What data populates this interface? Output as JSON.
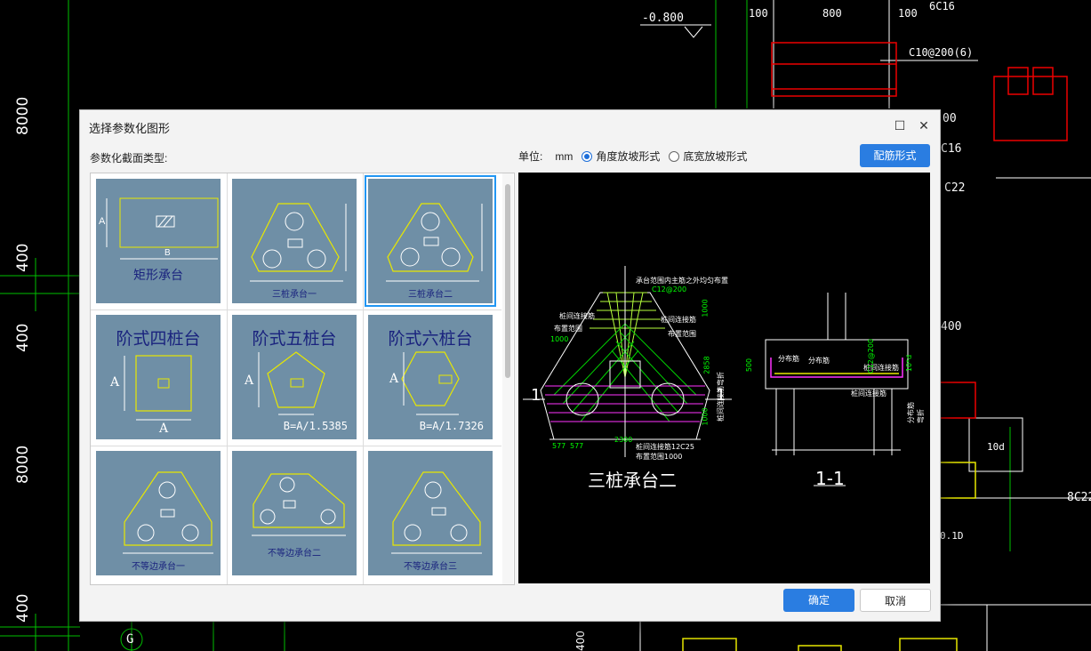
{
  "background_cad": {
    "dims": [
      "-0.800",
      "100",
      "800",
      "100",
      "6C16",
      "C10@200(6)",
      "8000",
      "400",
      "400",
      "8000",
      "400",
      "C22",
      "C16",
      "00",
      "400",
      "8C22",
      "10d",
      "0.1D",
      "G",
      "400"
    ]
  },
  "dialog": {
    "title": "选择参数化图形",
    "section_label": "参数化截面类型:",
    "unit_label": "单位:",
    "unit_value": "mm",
    "radio_angle": "角度放坡形式",
    "radio_width": "底宽放坡形式",
    "selected_radio": "angle",
    "rebar_button": "配筋形式",
    "ok_button": "确定",
    "cancel_button": "取消",
    "maximize_icon": "maximize-icon",
    "close_icon": "close-icon"
  },
  "gallery": {
    "tiles": [
      {
        "caption": "矩形承台",
        "labels": [
          "A",
          "B"
        ]
      },
      {
        "caption": "三桩承台一",
        "labels": []
      },
      {
        "caption": "三桩承台二",
        "labels": []
      },
      {
        "caption": "阶式四桩台",
        "labels": [
          "A",
          "A"
        ]
      },
      {
        "caption": "阶式五桩台",
        "labels": [
          "A"
        ],
        "formula": "B=A/1.5385"
      },
      {
        "caption": "阶式六桩台",
        "labels": [
          "A"
        ],
        "formula": "B=A/1.7326"
      },
      {
        "caption": "不等边承台一",
        "labels": []
      },
      {
        "caption": "不等边承台二",
        "labels": []
      },
      {
        "caption": "不等边承台三",
        "labels": []
      }
    ],
    "selected_index": 2
  },
  "preview": {
    "title": "三桩承台二",
    "section_title": "1-1",
    "section_mark": "1",
    "notes": {
      "top_note": "承台范围内主筋之外均匀布置",
      "top_rebar": "C12@200",
      "left_a": "桩间连接筋",
      "left_b": "布置范围",
      "left_c": "1000",
      "right_a": "桩间连接筋",
      "right_b": "布置范围",
      "bottom_a": "桩间连接筋12C25",
      "bottom_b": "布置范围1000",
      "dim_1000_top": "1000",
      "dim_2858": "2858",
      "dim_1000_bot": "1000",
      "dim_2300": "2300",
      "dim_577a": "577",
      "dim_577b": "577",
      "sec_fbj1": "分布筋",
      "sec_fbj2": "分布筋",
      "sec_zjlj": "桩间连接筋",
      "sec_500": "500",
      "sec_10d": "10*d",
      "sec_side_l": "桩间连接筋弯折",
      "sec_side_r": "分布筋弯折",
      "sec_c12": "C12@200"
    }
  },
  "colors": {
    "accent": "#2a7de1",
    "tile_bg": "#6f8fa6",
    "selected_border": "#2196f3"
  }
}
